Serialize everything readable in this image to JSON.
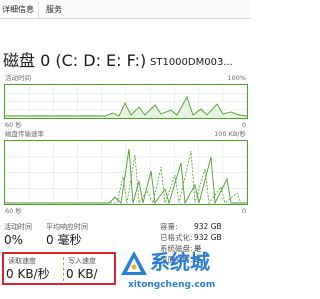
{
  "tabs": [
    {
      "label": "详细信息"
    },
    {
      "label": "服务"
    }
  ],
  "header": {
    "title": "磁盘 0 (C: D: E: F:)",
    "model": "ST1000DM003..."
  },
  "activity_chart": {
    "top_label": "活动时间",
    "top_right": "100%",
    "bottom_left": "60 秒",
    "bottom_right": "0",
    "line_color": "#4aa02c",
    "fill_color": "#e6f3df"
  },
  "transfer_chart": {
    "top_label": "磁盘传输速率",
    "top_right": "100 KB/秒",
    "bottom_left": "60 秒",
    "bottom_right": "0",
    "line_color": "#4aa02c",
    "dash_color": "#4aa02c"
  },
  "stats": {
    "active_time_label": "活动时间",
    "active_time_value": "0%",
    "avg_response_label": "平均响应时间",
    "avg_response_value": "0 毫秒",
    "read_label": "读取速度",
    "read_value": "0 KB/秒",
    "write_label": "写入速度",
    "write_value": "0 KB/"
  },
  "info": [
    {
      "key": "容量:",
      "value": "932 GB"
    },
    {
      "key": "已格式化:",
      "value": "932 GB"
    },
    {
      "key": "系统磁盘:",
      "value": "是"
    },
    {
      "key": "页面文件:",
      "value": "是"
    }
  ],
  "highlight_color": "#d9212c",
  "watermark": {
    "text": "系统城",
    "url": "xitongcheng.com",
    "color": "#2a7fd4"
  }
}
